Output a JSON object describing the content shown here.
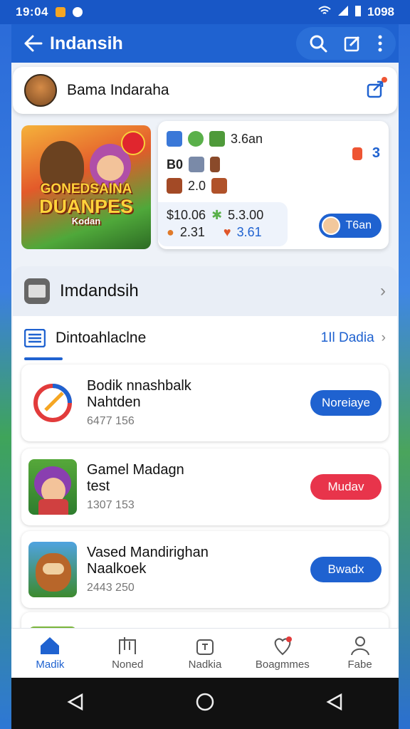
{
  "status": {
    "time": "19:04",
    "battery": "1098"
  },
  "appbar": {
    "title": "Indansih"
  },
  "user": {
    "name": "Bama Indaraha"
  },
  "banner": {
    "line1": "GONEDSAINA",
    "line2": "DUANPES",
    "line3": "Kodan"
  },
  "stats": {
    "r1": "3.6an",
    "r2": "B0",
    "r3": "2.0",
    "r4a": "$10.06",
    "r4b": "5.3.00",
    "r5a": "2.31",
    "r5b": "3.61",
    "corner": "3",
    "pill": "T6an"
  },
  "section": {
    "title": "Imdandsih"
  },
  "list_header": {
    "title": "Dintoahlaclne",
    "link": "1Il Dadia"
  },
  "items": [
    {
      "name": "Bodik nnashbalk",
      "sub": "Nahtden",
      "meta": "6477 156",
      "button": "Noreiaye",
      "color": "#1f62d0"
    },
    {
      "name": "Gamel Madagn",
      "sub": "test",
      "meta": "1307 153",
      "button": "Mudav",
      "color": "#e8344b"
    },
    {
      "name": "Vased Mandirighan",
      "sub": "Naalkoek",
      "meta": "2443 250",
      "button": "Bwadx",
      "color": "#1f62d0"
    }
  ],
  "nav": [
    "Madik",
    "Noned",
    "Nadkia",
    "Boagmmes",
    "Fabe"
  ]
}
